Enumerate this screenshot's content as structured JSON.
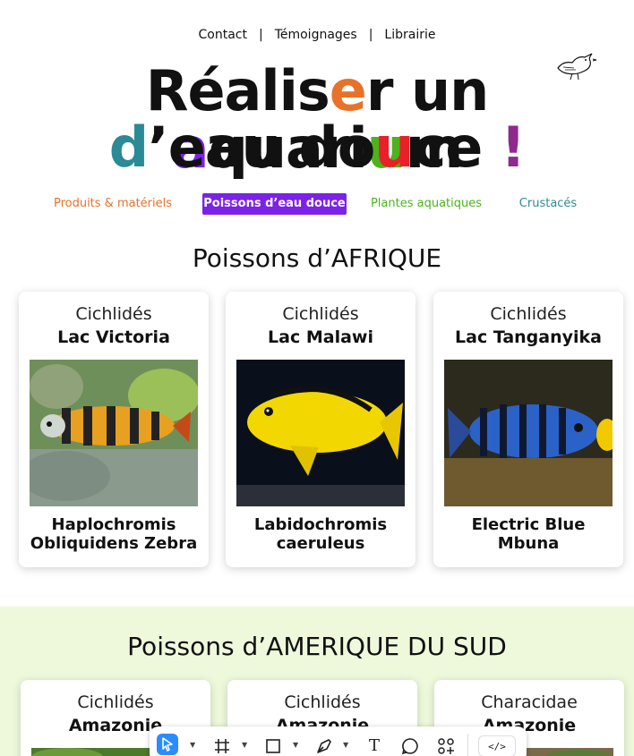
{
  "topnav": {
    "items": [
      "Contact",
      "Témoignages",
      "Librairie"
    ],
    "separator": "|"
  },
  "title": {
    "line1": [
      "R",
      "é",
      "a",
      "l",
      "i",
      "s",
      "e",
      "r",
      " ",
      "u",
      "n",
      " ",
      "a",
      "q",
      "u",
      "a",
      "r",
      "i",
      "u",
      "m"
    ],
    "line2": [
      "d",
      "’",
      "e",
      "a",
      "u",
      " ",
      "d",
      "o",
      "u",
      "c",
      "e",
      " ",
      "!"
    ],
    "colors": {
      "orange": "#e8722a",
      "purple": "#7b22e6",
      "green": "#4cb31a",
      "teal": "#2a8a96",
      "red": "#e8202a",
      "magenta": "#8e2a8e",
      "black": "#111111"
    }
  },
  "categories": [
    {
      "label": "Produits & matériels",
      "color": "#e8722a",
      "active": false
    },
    {
      "label": "Poissons d’eau douce",
      "color": "#ffffff",
      "active": true
    },
    {
      "label": "Plantes aquatiques",
      "color": "#4cb31a",
      "active": false
    },
    {
      "label": "Crustacés",
      "color": "#2a8a96",
      "active": false
    }
  ],
  "sections": [
    {
      "title": "Poissons d’AFRIQUE",
      "cards": [
        {
          "family": "Cichlidés",
          "region": "Lac Victoria",
          "name_line1": "Haplochromis",
          "name_line2": "Obliquidens Zebra",
          "photo": "striped-orange-cichlid"
        },
        {
          "family": "Cichlidés",
          "region": "Lac Malawi",
          "name_line1": "Labidochromis",
          "name_line2": "caeruleus",
          "photo": "yellow-cichlid"
        },
        {
          "family": "Cichlidés",
          "region": "Lac Tanganyika",
          "name_line1": "Electric Blue",
          "name_line2": "Mbuna",
          "photo": "blue-striped-cichlid"
        }
      ]
    },
    {
      "title": "Poissons d’AMERIQUE DU SUD",
      "cards": [
        {
          "family": "Cichlidés",
          "region": "Amazonie",
          "photo": "aquarium-plants"
        },
        {
          "family": "Cichlidés",
          "region": "Amazonie",
          "photo": "aquarium-plants"
        },
        {
          "family": "Characidae",
          "region": "Amazonie",
          "photo": "aquarium-plants"
        }
      ]
    }
  ],
  "toolbar": {
    "tools": [
      "cursor-icon",
      "frame-icon",
      "rectangle-icon",
      "pen-icon",
      "text-icon",
      "comment-icon",
      "components-icon",
      "code-icon"
    ],
    "text_glyph": "T",
    "code_glyph": "</>",
    "selected_tool": "cursor-icon",
    "selected_color": "#2a8cff"
  }
}
